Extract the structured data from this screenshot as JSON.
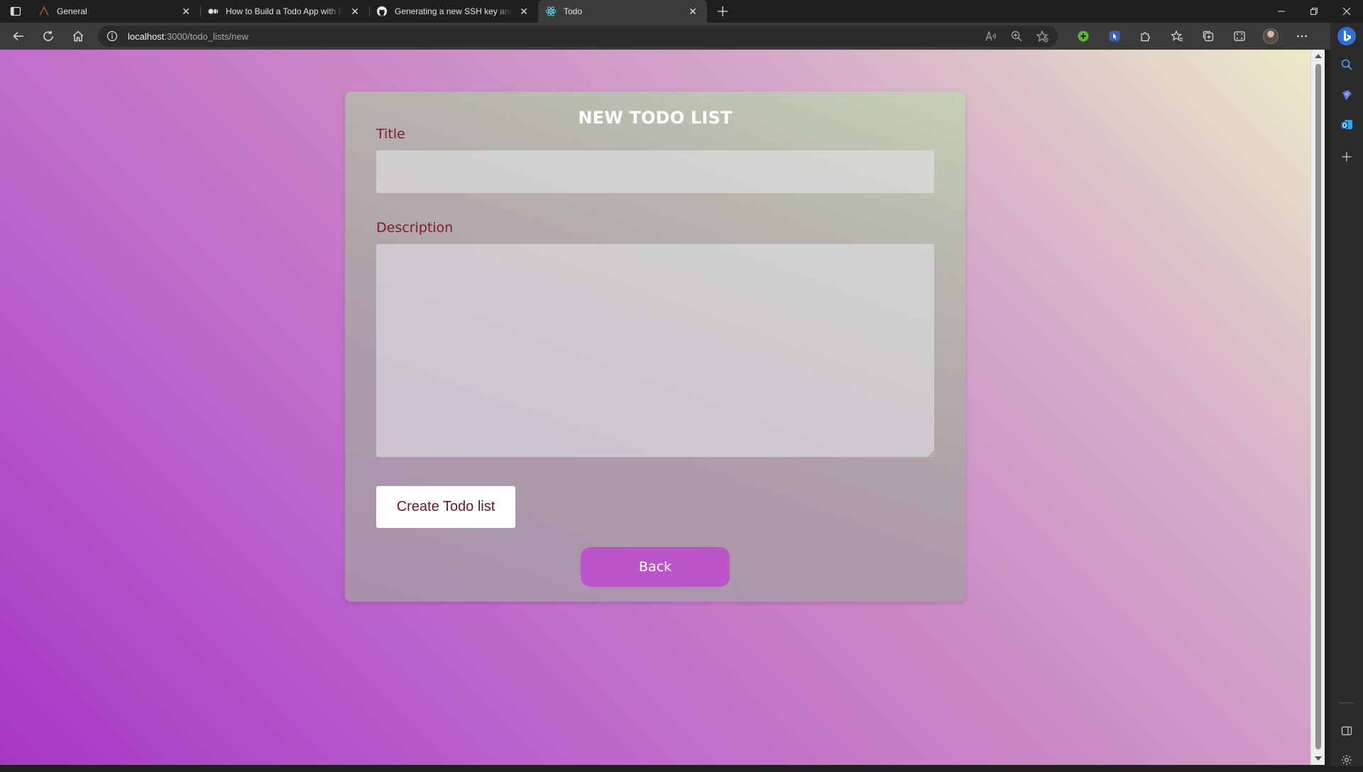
{
  "browser": {
    "tabs": [
      {
        "title": "General",
        "icon": "arc-app-icon",
        "active": false
      },
      {
        "title": "How to Build a Todo App with React",
        "icon": "medium-icon",
        "active": false
      },
      {
        "title": "Generating a new SSH key and adding it to the ssh-agent",
        "icon": "github-icon",
        "active": false
      },
      {
        "title": "Todo",
        "icon": "react-icon",
        "active": true
      }
    ],
    "address": {
      "host": "localhost",
      "path": ":3000/todo_lists/new"
    }
  },
  "page": {
    "heading": "NEW TODO LIST",
    "title_label": "Title",
    "title_value": "",
    "description_label": "Description",
    "description_value": "",
    "create_button": "Create Todo list",
    "back_button": "Back"
  },
  "colors": {
    "label": "#7a1d2c",
    "back_button": "#bb55c9",
    "create_button_text": "#6b1424"
  }
}
